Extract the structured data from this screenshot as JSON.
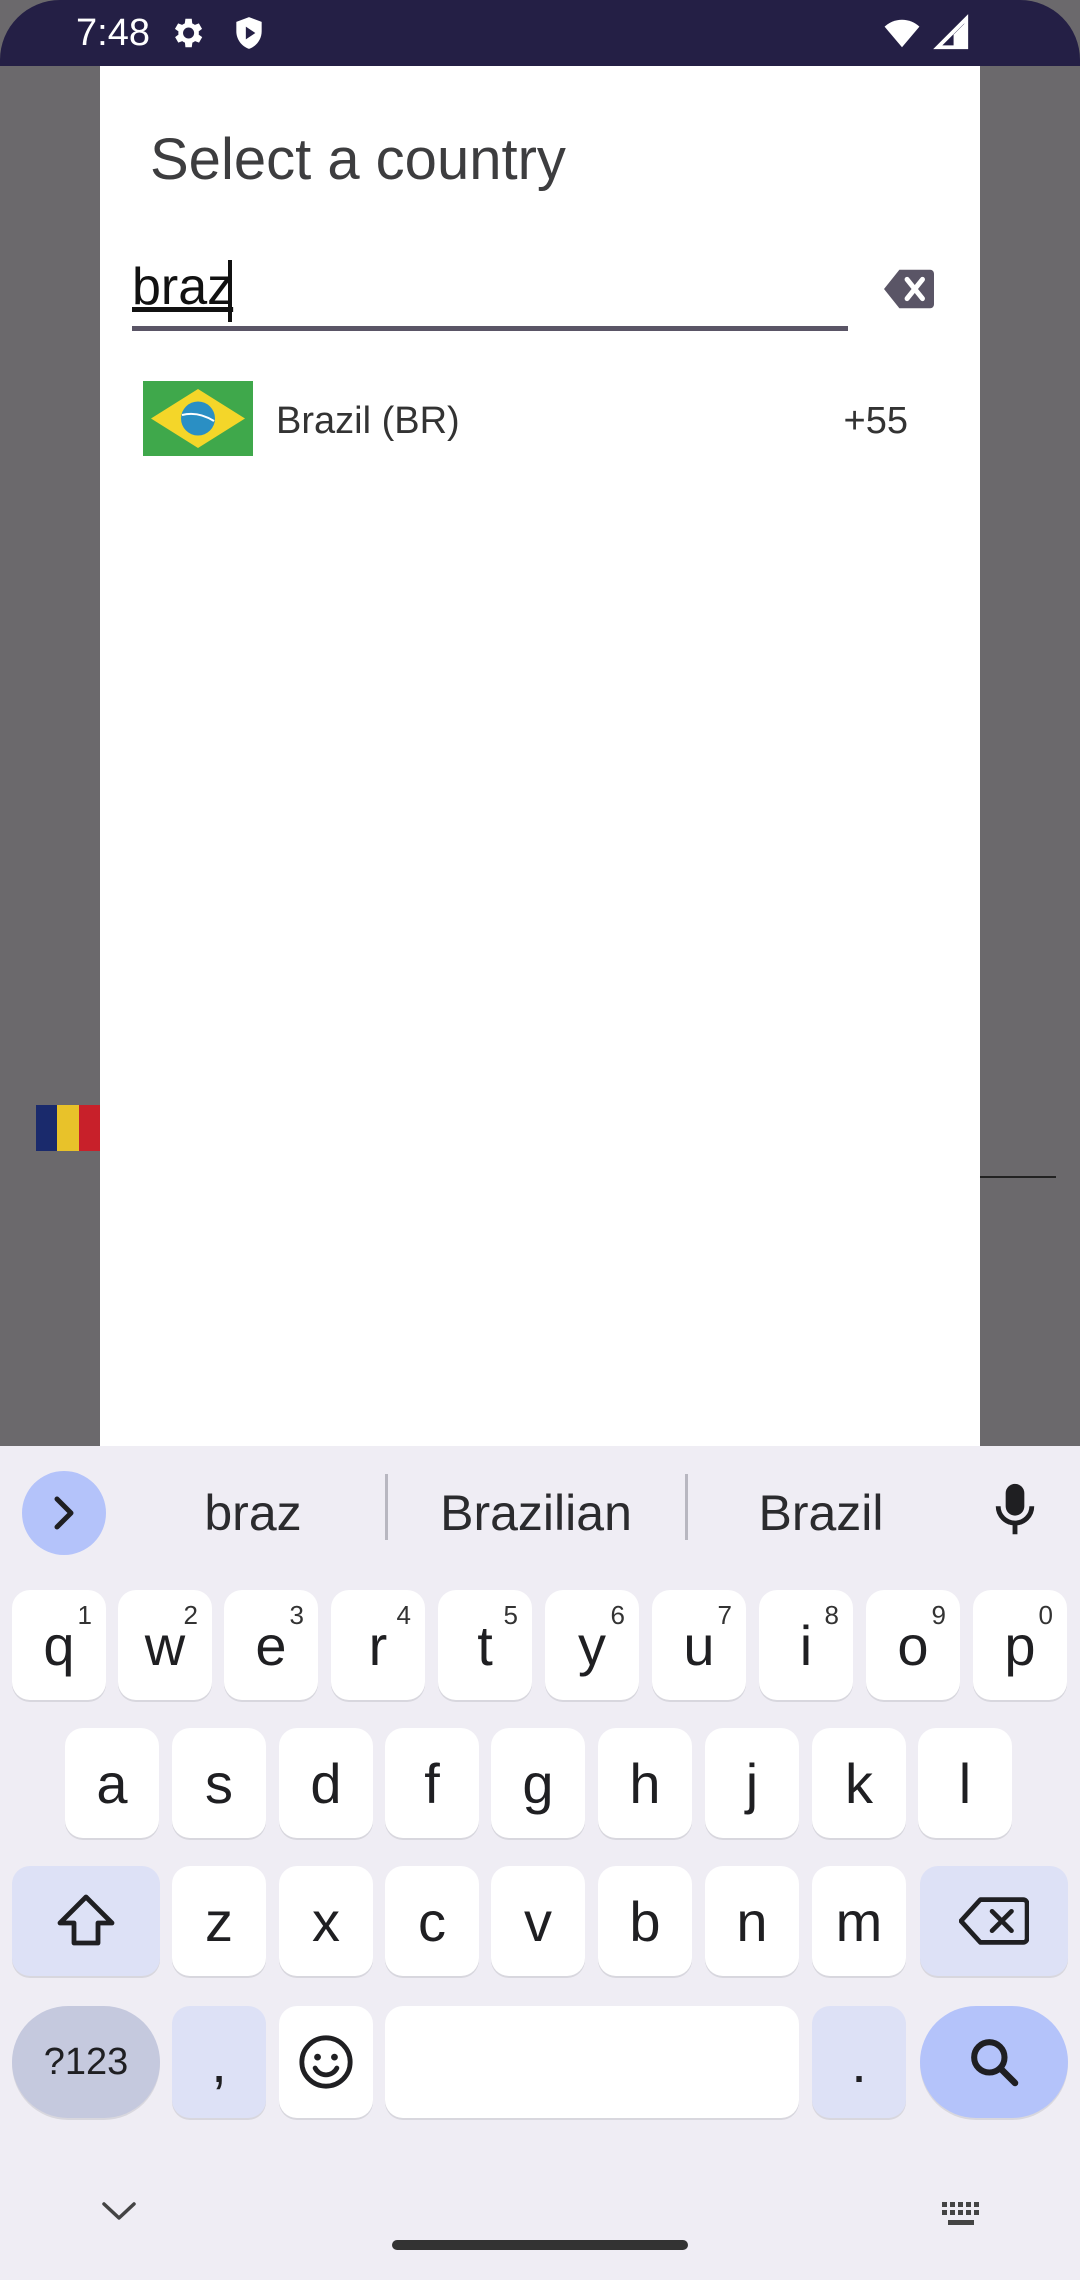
{
  "status_bar": {
    "time": "7:48",
    "left_icons": [
      "settings-icon",
      "shield-play-icon"
    ],
    "right_icons": [
      "wifi-icon",
      "signal-icon"
    ]
  },
  "dialog": {
    "title": "Select a country",
    "search": {
      "value": "braz",
      "placeholder": ""
    },
    "results": [
      {
        "flag": "brazil-flag",
        "name": "Brazil (BR)",
        "dial_code": "+55"
      }
    ]
  },
  "keyboard": {
    "suggestions": [
      "braz",
      "Brazilian",
      "Brazil"
    ],
    "row1": [
      {
        "k": "q",
        "h": "1"
      },
      {
        "k": "w",
        "h": "2"
      },
      {
        "k": "e",
        "h": "3"
      },
      {
        "k": "r",
        "h": "4"
      },
      {
        "k": "t",
        "h": "5"
      },
      {
        "k": "y",
        "h": "6"
      },
      {
        "k": "u",
        "h": "7"
      },
      {
        "k": "i",
        "h": "8"
      },
      {
        "k": "o",
        "h": "9"
      },
      {
        "k": "p",
        "h": "0"
      }
    ],
    "row2": [
      "a",
      "s",
      "d",
      "f",
      "g",
      "h",
      "j",
      "k",
      "l"
    ],
    "row3": [
      "z",
      "x",
      "c",
      "v",
      "b",
      "n",
      "m"
    ],
    "symbols_label": "?123",
    "comma_label": ",",
    "period_label": ".",
    "colors": {
      "accent": "#b4c3fa",
      "modifier": "#dde1f6",
      "background": "#efedf4"
    }
  }
}
